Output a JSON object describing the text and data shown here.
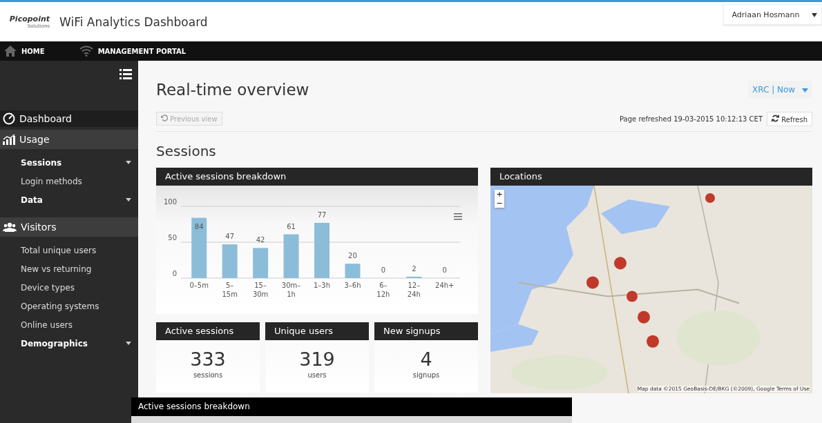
{
  "header": {
    "logo": {
      "name": "Picopoint",
      "tagline": "Solutions"
    },
    "title": "WiFi Analytics Dashboard",
    "user_menu": "Adriaan Hosmann"
  },
  "nav": [
    {
      "label": "HOME"
    },
    {
      "label": "MANAGEMENT PORTAL"
    }
  ],
  "sidebar": {
    "sections": [
      {
        "label": "Dashboard",
        "kind": "link"
      },
      {
        "label": "Usage",
        "kind": "group",
        "items": [
          {
            "label": "Sessions",
            "expandable": true
          },
          {
            "label": "Login methods",
            "expandable": false
          },
          {
            "label": "Data",
            "expandable": true
          }
        ]
      },
      {
        "label": "Visitors",
        "kind": "group",
        "items": [
          {
            "label": "Total unique users",
            "expandable": false
          },
          {
            "label": "New vs returning",
            "expandable": false
          },
          {
            "label": "Device types",
            "expandable": false
          },
          {
            "label": "Operating systems",
            "expandable": false
          },
          {
            "label": "Online users",
            "expandable": false
          },
          {
            "label": "Demographics",
            "expandable": true
          }
        ]
      }
    ]
  },
  "main": {
    "title": "Real-time overview",
    "scope": "XRC | Now",
    "previous_view": "Previous view",
    "refreshed": "Page refreshed 19-03-2015 10:12:13 CET",
    "refresh": "Refresh",
    "section": "Sessions",
    "breakdown": {
      "title": "Active sessions breakdown",
      "chart_data": {
        "type": "bar",
        "categories": [
          "0–5m",
          "5–15m",
          "15–30m",
          "30m–1h",
          "1–3h",
          "3–6h",
          "6–12h",
          "12–24h",
          "24h+"
        ],
        "values": [
          84,
          47,
          42,
          61,
          77,
          20,
          0,
          2,
          0
        ],
        "ylim": [
          0,
          100
        ],
        "yticks": [
          0,
          50,
          100
        ],
        "data_labels": true
      }
    },
    "stats": [
      {
        "title": "Active sessions",
        "value": "333",
        "unit": "sessions"
      },
      {
        "title": "Unique users",
        "value": "319",
        "unit": "users"
      },
      {
        "title": "New signups",
        "value": "4",
        "unit": "signups"
      }
    ],
    "locations": {
      "title": "Locations",
      "zoom_in": "+",
      "zoom_out": "−",
      "attribution": "Map data ©2015 GeoBasis-DE/BKG (©2009), Google   Terms of Use"
    }
  },
  "overlay": {
    "title": "Active sessions breakdown"
  }
}
